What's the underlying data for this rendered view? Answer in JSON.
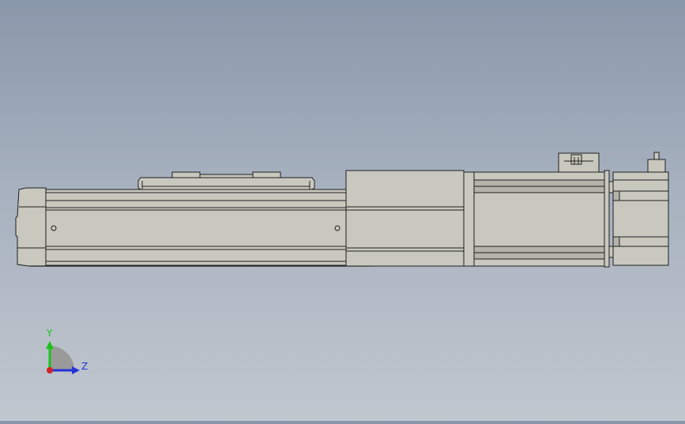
{
  "view": {
    "background_top": "#8a98ab",
    "background_bottom": "#c1c7cf",
    "model_fill": "#c8c8bf",
    "model_fill_dark": "#b4b4aa",
    "edge_color": "#1f1f1f"
  },
  "triad": {
    "y_label": "Y",
    "z_label": "Z",
    "y_color": "#19c219",
    "z_color": "#2433d6",
    "x_color": "#d42222"
  }
}
